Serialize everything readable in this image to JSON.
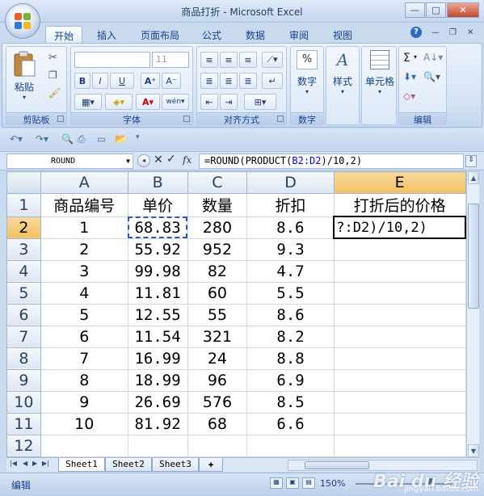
{
  "window": {
    "title": "商品打折 - Microsoft Excel",
    "min": "—",
    "max": "□",
    "close": "✕"
  },
  "ribbon": {
    "tabs": [
      "开始",
      "插入",
      "页面布局",
      "公式",
      "数据",
      "审阅",
      "视图"
    ],
    "active_tab": "开始",
    "help": "?",
    "groups": {
      "clipboard": {
        "label": "剪贴板",
        "paste": "粘贴"
      },
      "font": {
        "label": "字体",
        "font_size": "11",
        "bold": "B",
        "italic": "I",
        "underline": "U"
      },
      "alignment": {
        "label": "对齐方式"
      },
      "number": {
        "label": "数字",
        "button": "数字",
        "percent": "%"
      },
      "styles": {
        "button": "样式"
      },
      "cells": {
        "button": "单元格"
      },
      "editing": {
        "label": "编辑",
        "sum": "Σ"
      }
    }
  },
  "formula_bar": {
    "name_box": "ROUND",
    "fx": "fx",
    "formula_prefix": "=ROUND(PRODUCT(",
    "formula_ref": "B2:D2",
    "formula_suffix": ")/10,2)"
  },
  "sheet": {
    "columns": [
      "A",
      "B",
      "C",
      "D",
      "E"
    ],
    "selected_column": "E",
    "selected_row": "2",
    "rows": [
      {
        "n": "1",
        "a": "商品编号",
        "b": "单价",
        "c": "数量",
        "d": "折扣",
        "e": "打折后的价格"
      },
      {
        "n": "2",
        "a": "1",
        "b": "68.83",
        "c": "280",
        "d": "8.6",
        "e": "?:D2)/10,2)"
      },
      {
        "n": "3",
        "a": "2",
        "b": "55.92",
        "c": "952",
        "d": "9.3",
        "e": ""
      },
      {
        "n": "4",
        "a": "3",
        "b": "99.98",
        "c": "82",
        "d": "4.7",
        "e": ""
      },
      {
        "n": "5",
        "a": "4",
        "b": "11.81",
        "c": "60",
        "d": "5.5",
        "e": ""
      },
      {
        "n": "6",
        "a": "5",
        "b": "12.55",
        "c": "55",
        "d": "8.6",
        "e": ""
      },
      {
        "n": "7",
        "a": "6",
        "b": "11.54",
        "c": "321",
        "d": "8.2",
        "e": ""
      },
      {
        "n": "8",
        "a": "7",
        "b": "16.99",
        "c": "24",
        "d": "8.8",
        "e": ""
      },
      {
        "n": "9",
        "a": "8",
        "b": "18.99",
        "c": "96",
        "d": "6.9",
        "e": ""
      },
      {
        "n": "10",
        "a": "9",
        "b": "26.69",
        "c": "576",
        "d": "8.5",
        "e": ""
      },
      {
        "n": "11",
        "a": "10",
        "b": "81.92",
        "c": "68",
        "d": "6.6",
        "e": ""
      },
      {
        "n": "12",
        "a": "",
        "b": "",
        "c": "",
        "d": "",
        "e": ""
      }
    ],
    "sheet_tabs": [
      "Sheet1",
      "Sheet2",
      "Sheet3"
    ],
    "active_sheet": "Sheet1"
  },
  "status": {
    "mode": "编辑",
    "zoom": "150%"
  },
  "watermark": {
    "brand": "Bai du 经验",
    "url": "jingyan.baidu.com"
  },
  "colors": {
    "ribbon_bg": "#d5e3f5",
    "selected_header": "#f1c15f",
    "range_ref": "#0000ff"
  }
}
